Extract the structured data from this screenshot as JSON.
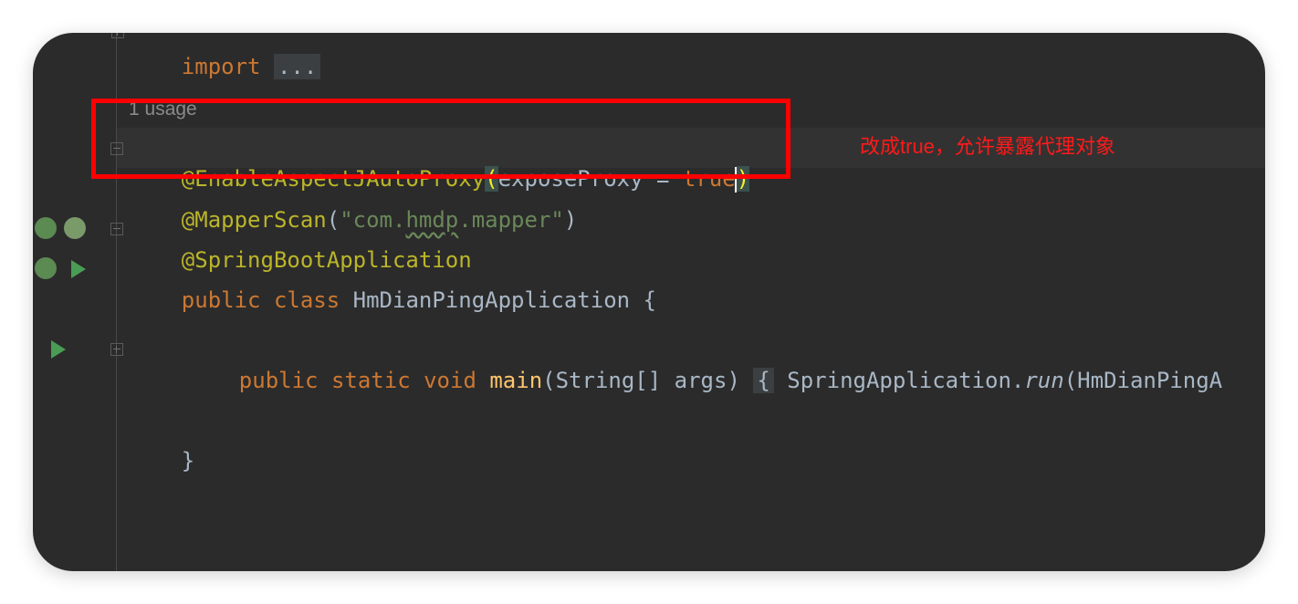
{
  "editor": {
    "import_line": {
      "keyword": "import",
      "folded": "..."
    },
    "usage_hint": "1 usage",
    "lines": {
      "enable_aspect": {
        "annotation": "@EnableAspectJAutoProxy",
        "open_paren": "(",
        "param": "exposeProxy = ",
        "value": "true",
        "close_paren": ")"
      },
      "mapper_scan": {
        "annotation": "@MapperScan",
        "open": "(",
        "string_pre": "\"com.",
        "string_squiggle": "hmdp",
        "string_post": ".mapper\"",
        "close": ")"
      },
      "spring_boot_app": {
        "annotation": "@SpringBootApplication"
      },
      "class_decl": {
        "kw_public": "public",
        "kw_class": "class",
        "name": "HmDianPingApplication",
        "brace": "{"
      },
      "main_method": {
        "kw_public": "public",
        "kw_static": "static",
        "kw_void": "void",
        "name": "main",
        "params": "(String[] args)",
        "folded_brace": "{",
        "call_obj": "SpringApplication.",
        "call_fn": "run",
        "call_args": "(HmDianPingA"
      },
      "close_brace": "}"
    },
    "gutter_icons": [
      "bean-search-icon",
      "bean-check-icon",
      "bean-run-icon",
      "run-icon",
      "run-main-icon"
    ],
    "colors": {
      "background": "#2b2b2b",
      "annotation": "#bbb529",
      "keyword": "#cc7832",
      "string": "#6a8759",
      "function": "#ffc66d",
      "plain": "#a9b7c6"
    }
  },
  "overlay": {
    "note": "改成true，允许暴露代理对象",
    "highlight_color": "#ff0000"
  }
}
